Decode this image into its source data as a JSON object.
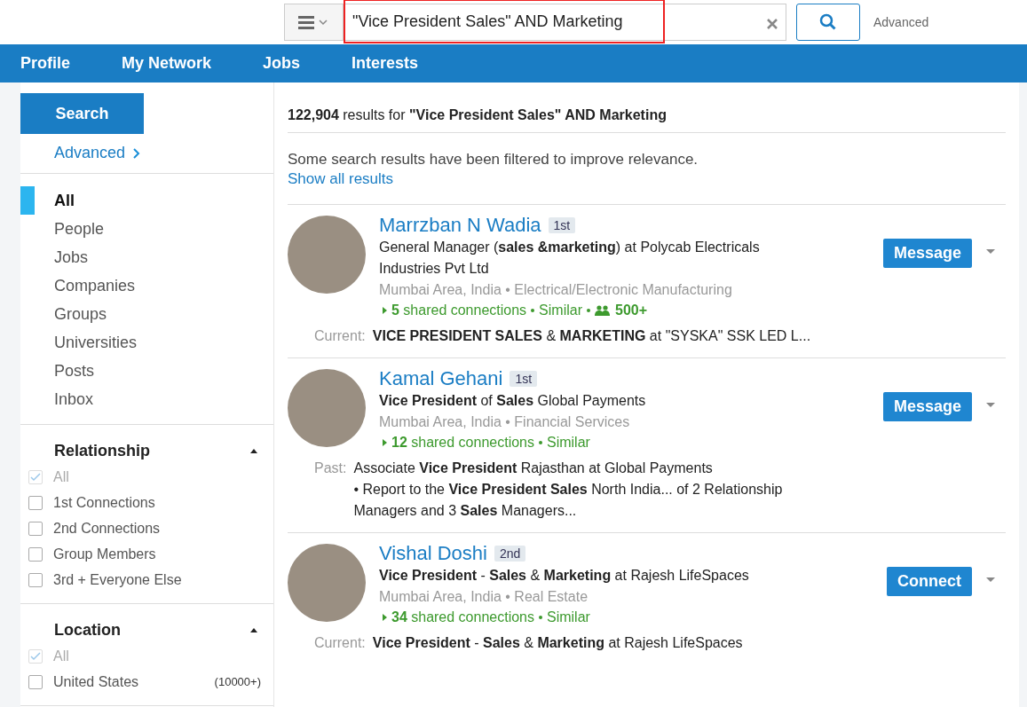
{
  "search": {
    "value": "\"Vice President Sales\" AND Marketing",
    "highlighted": true,
    "advanced": "Advanced"
  },
  "nav": [
    {
      "label": "Profile"
    },
    {
      "label": "My Network"
    },
    {
      "label": "Jobs"
    },
    {
      "label": "Interests"
    }
  ],
  "sidebar": {
    "search_button": "Search",
    "advanced_link": "Advanced",
    "categories": [
      {
        "label": "All",
        "selected": true
      },
      {
        "label": "People",
        "selected": false
      },
      {
        "label": "Jobs",
        "selected": false
      },
      {
        "label": "Companies",
        "selected": false
      },
      {
        "label": "Groups",
        "selected": false
      },
      {
        "label": "Universities",
        "selected": false
      },
      {
        "label": "Posts",
        "selected": false
      },
      {
        "label": "Inbox",
        "selected": false
      }
    ],
    "filters": [
      {
        "title": "Relationship",
        "expanded": true,
        "options": [
          {
            "label": "All",
            "checked": true,
            "disabled": true
          },
          {
            "label": "1st Connections",
            "checked": false,
            "disabled": false
          },
          {
            "label": "2nd Connections",
            "checked": false,
            "disabled": false
          },
          {
            "label": "Group Members",
            "checked": false,
            "disabled": false
          },
          {
            "label": "3rd + Everyone Else",
            "checked": false,
            "disabled": false
          }
        ]
      },
      {
        "title": "Location",
        "expanded": true,
        "options": [
          {
            "label": "All",
            "checked": true,
            "disabled": true
          },
          {
            "label": "United States",
            "count": "(10000+)",
            "checked": false,
            "disabled": false
          }
        ]
      }
    ]
  },
  "results_header": "**122,904** results for **\"Vice President Sales\" AND Marketing**",
  "notice": {
    "text": "Some search results have been filtered to improve relevance.",
    "link": "Show all results"
  },
  "results": [
    {
      "name": "Marrzban N Wadia",
      "degree": "1st",
      "headline": "General Manager (**sales &marketing**) at Polycab Electricals Industries Pvt Ltd",
      "meta": "Mumbai Area, India • Electrical/Electronic Manufacturing",
      "shared": "**5** shared connections",
      "similar": "Similar",
      "followers": "500+",
      "snippet_label": "Current:",
      "snippet": [
        "**VICE PRESIDENT SALES** & **MARKETING** at \"SYSKA\" SSK LED L..."
      ],
      "action": "Message"
    },
    {
      "name": "Kamal Gehani",
      "degree": "1st",
      "headline": "**Vice President** of **Sales** Global Payments",
      "meta": "Mumbai Area, India • Financial Services",
      "shared": "**12** shared connections",
      "similar": "Similar",
      "snippet_label": "Past:",
      "snippet": [
        "Associate **Vice President** Rajasthan at Global Payments",
        "• Report to the **Vice President Sales** North India... of 2 Relationship Managers and 3 **Sales** Managers..."
      ],
      "action": "Message"
    },
    {
      "name": "Vishal Doshi",
      "degree": "2nd",
      "headline": "**Vice President** - **Sales** & **Marketing** at Rajesh LifeSpaces",
      "meta": "Mumbai Area, India • Real Estate",
      "shared": "**34** shared connections",
      "similar": "Similar",
      "snippet_label": "Current:",
      "snippet": [
        "**Vice President** - **Sales** & **Marketing** at Rajesh LifeSpaces"
      ],
      "action": "Connect"
    }
  ]
}
